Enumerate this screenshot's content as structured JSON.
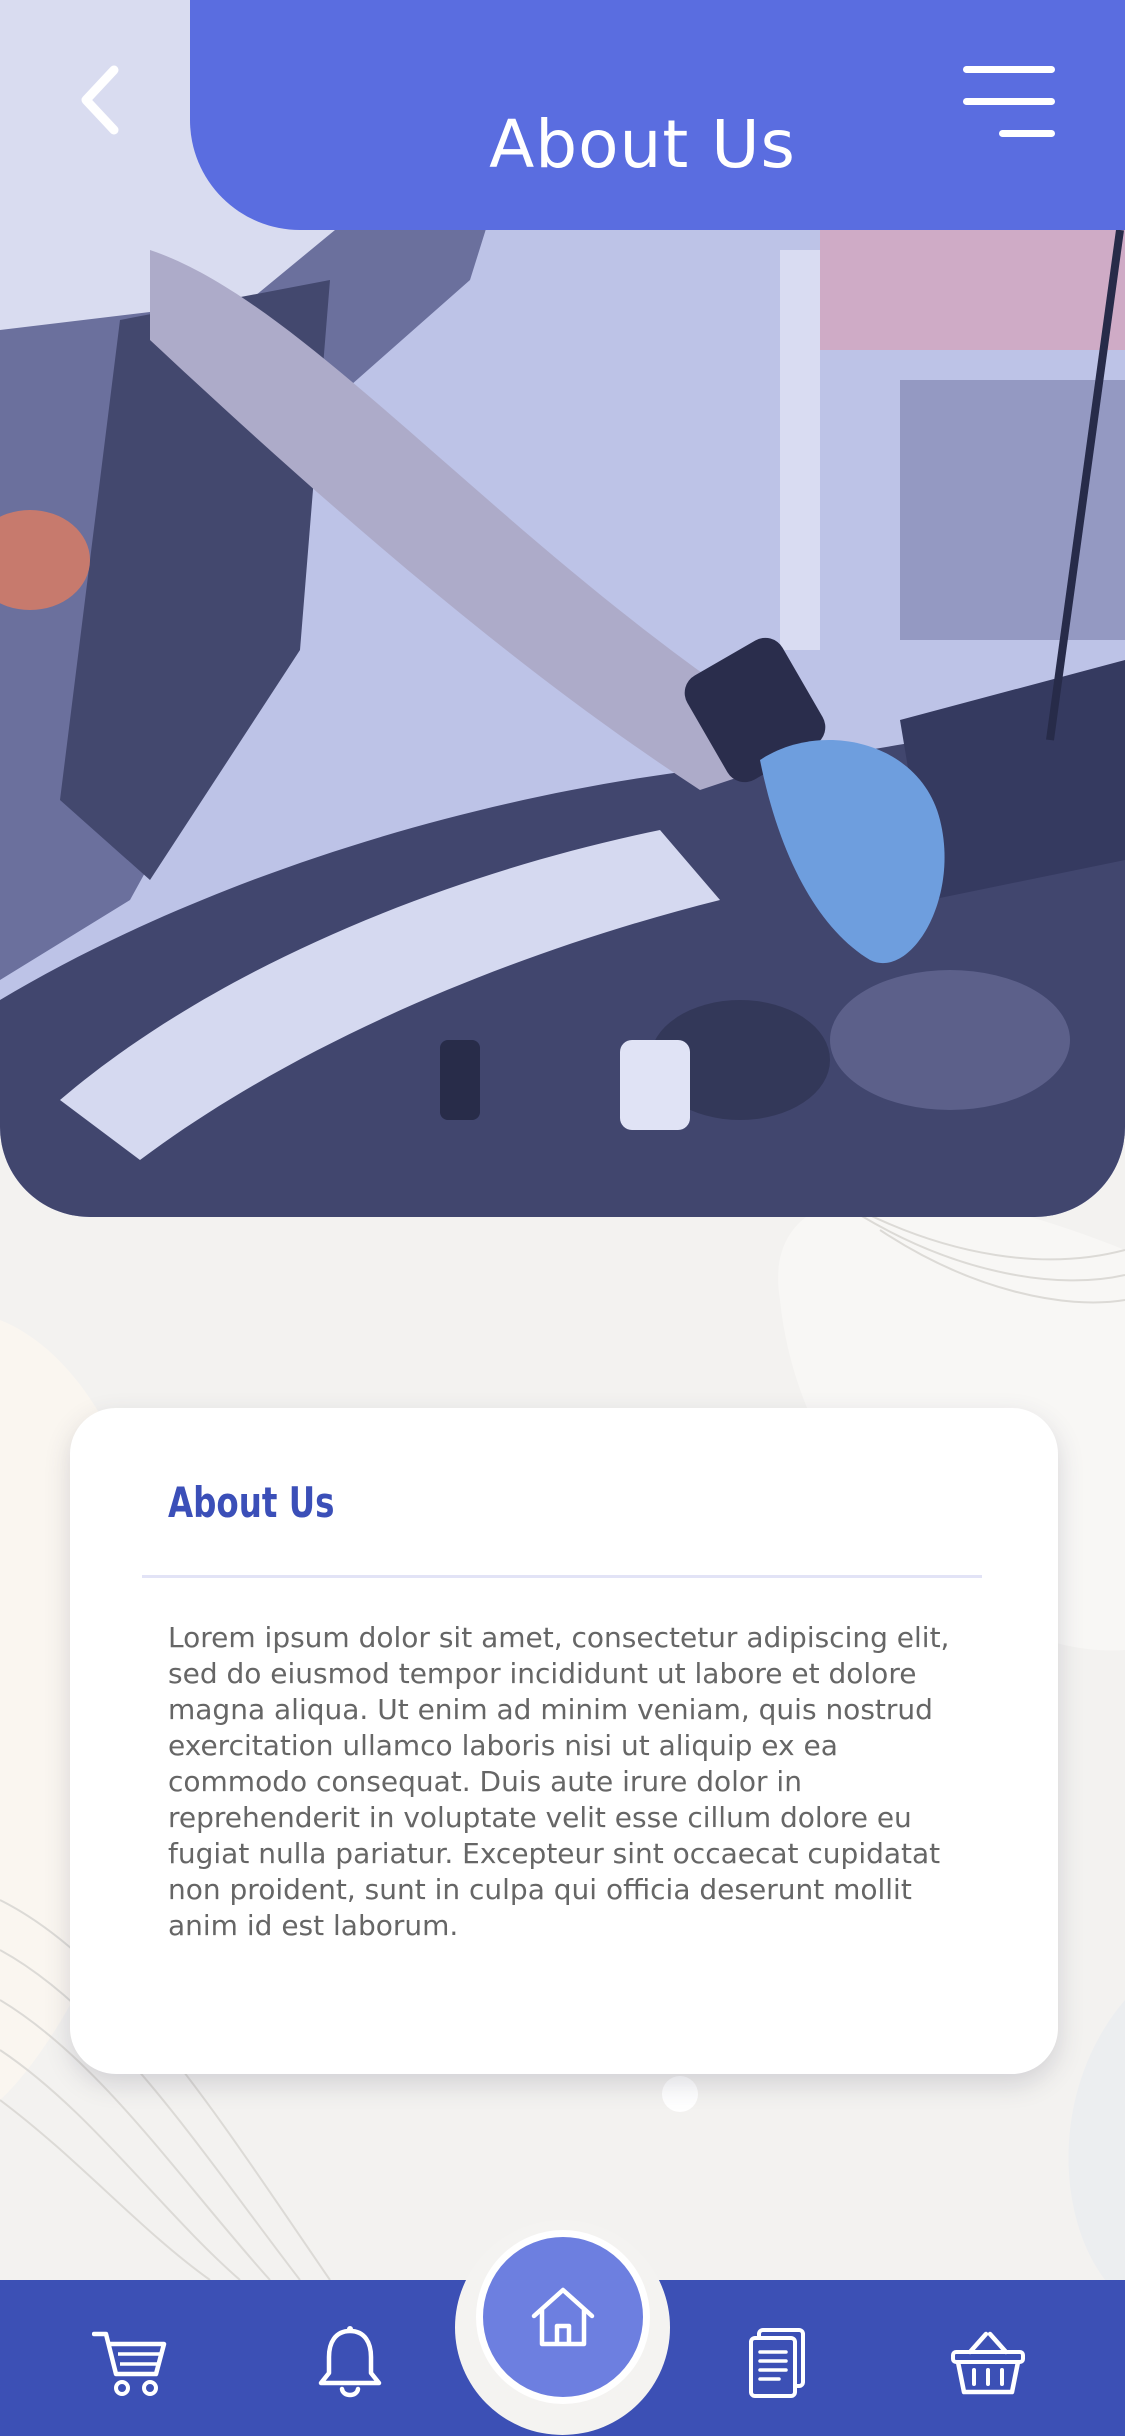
{
  "header": {
    "title": "About Us",
    "back_icon": "chevron-left-icon",
    "menu_icon": "hamburger-menu-icon",
    "color": "#5a6de0"
  },
  "hero": {
    "description_icon": "hero-photo"
  },
  "about": {
    "heading": "About Us",
    "body": "Lorem ipsum dolor sit amet, consectetur adipiscing elit, sed do eiusmod tempor incididunt ut labore et dolore magna aliqua. Ut enim ad minim veniam, quis nostrud exercitation ullamco laboris nisi ut aliquip ex ea commodo consequat. Duis aute irure dolor in reprehenderit in voluptate velit esse cillum dolore eu fugiat nulla pariatur. Excepteur sint occaecat cupidatat non proident, sunt in culpa qui officia deserunt mollit anim id est laborum.",
    "heading_color": "#3b4fb8"
  },
  "bottom_nav": {
    "color": "#3c50b5",
    "items": [
      {
        "icon": "cart-icon"
      },
      {
        "icon": "bell-icon"
      },
      {
        "icon": "home-icon",
        "active": true
      },
      {
        "icon": "document-icon"
      },
      {
        "icon": "basket-icon"
      }
    ]
  }
}
